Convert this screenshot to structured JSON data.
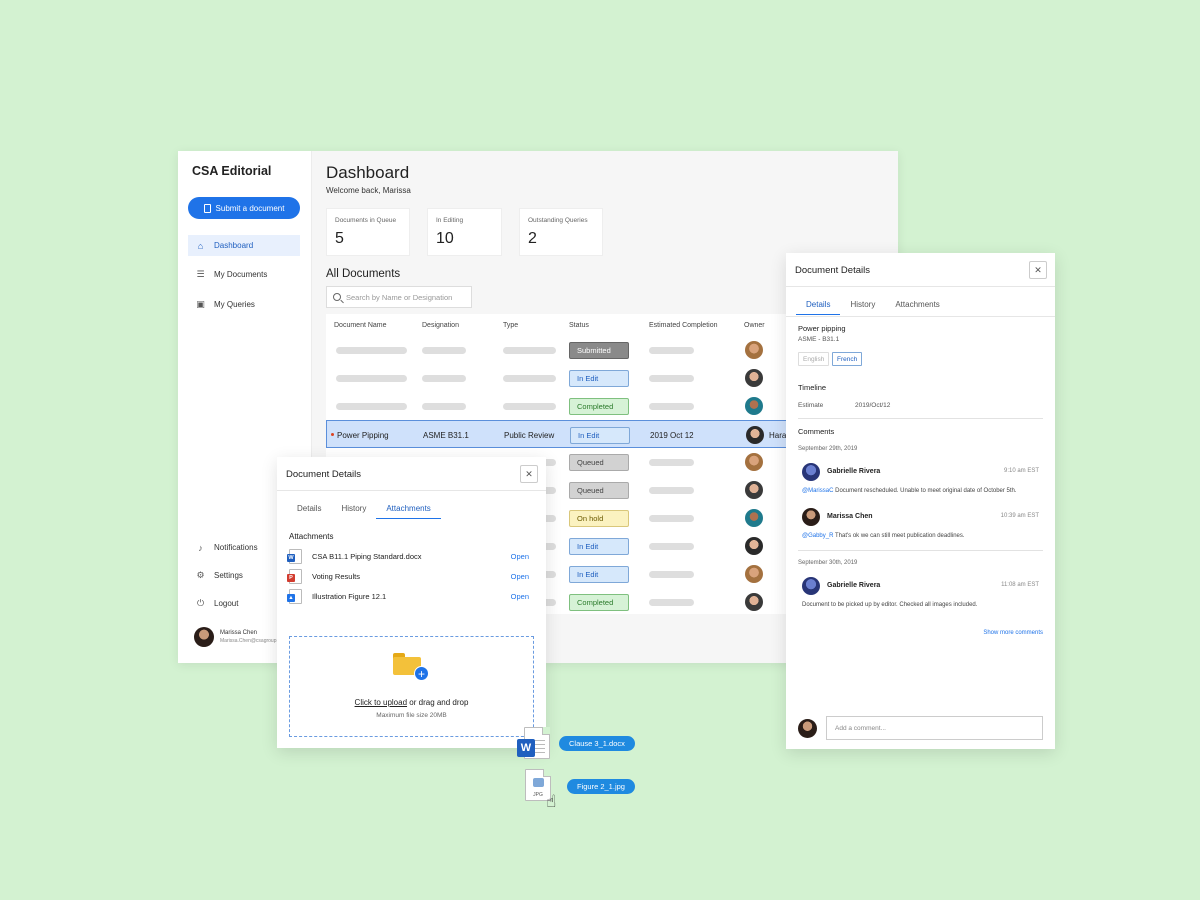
{
  "app": {
    "brand": "CSA Editorial",
    "submit_label": "Submit a document",
    "nav": [
      {
        "label": "Dashboard",
        "icon": "home-icon"
      },
      {
        "label": "My Documents",
        "icon": "list-icon"
      },
      {
        "label": "My Queries",
        "icon": "query-icon"
      }
    ],
    "bottom_nav": [
      {
        "label": "Notifications",
        "icon": "bell-icon"
      },
      {
        "label": "Settings",
        "icon": "gear-icon"
      },
      {
        "label": "Logout",
        "icon": "logout-icon"
      }
    ],
    "user": {
      "name": "Marissa Chen",
      "email": "Marissa.Chen@csagroup.org"
    }
  },
  "dashboard": {
    "title": "Dashboard",
    "welcome": "Welcome back, Marissa",
    "stats": [
      {
        "label": "Documents in Queue",
        "value": "5"
      },
      {
        "label": "In Editing",
        "value": "10"
      },
      {
        "label": "Outstanding Queries",
        "value": "2"
      }
    ],
    "section_title": "All Documents",
    "search_placeholder": "Search by Name or Designation",
    "columns": [
      "Document Name",
      "Designation",
      "Type",
      "Status",
      "Estimated Completion",
      "Owner"
    ],
    "rows": [
      {
        "status": "Submitted",
        "status_class": "submitted"
      },
      {
        "status": "In Edit",
        "status_class": "inedit"
      },
      {
        "status": "Completed",
        "status_class": "completed"
      },
      {
        "name": "Power Pipping",
        "designation": "ASME B31.1",
        "type": "Public Review",
        "status": "In Edit",
        "status_class": "inedit",
        "completion": "2019 Oct 12",
        "owner": "Hara",
        "selected": true
      },
      {
        "status": "Queued",
        "status_class": "queued"
      },
      {
        "status": "Queued",
        "status_class": "queued"
      },
      {
        "status": "On hold",
        "status_class": "onhold"
      },
      {
        "status": "In Edit",
        "status_class": "inedit"
      },
      {
        "status": "In Edit",
        "status_class": "inedit"
      },
      {
        "status": "Completed",
        "status_class": "completed"
      }
    ]
  },
  "left_panel": {
    "title": "Document Details",
    "tabs": [
      "Details",
      "History",
      "Attachments"
    ],
    "attachments_title": "Attachments",
    "attachments": [
      {
        "name": "CSA B11.1 Piping Standard.docx",
        "open": "Open",
        "badge": "W",
        "color": "#1f5fbf"
      },
      {
        "name": "Voting Results",
        "open": "Open",
        "badge": "P",
        "color": "#d23c2f"
      },
      {
        "name": "Illustration Figure 12.1",
        "open": "Open",
        "badge": "▲",
        "color": "#1f73e8"
      }
    ],
    "upload_link": "Click to upload",
    "upload_or": "or",
    "upload_drag": "drag and drop",
    "upload_max": "Maximum file size 20MB"
  },
  "right_panel": {
    "title": "Document Details",
    "tabs": [
      "Details",
      "History",
      "Attachments"
    ],
    "doc_name": "Power pipping",
    "doc_designation": "ASME - B31.1",
    "languages": [
      "English",
      "French"
    ],
    "timeline_title": "Timeline",
    "estimate_label": "Estimate",
    "estimate_value": "2019/Oct/12",
    "comments_title": "Comments",
    "comment_groups": [
      {
        "date": "September 29th, 2019",
        "comments": [
          {
            "author": "Gabrielle Rivera",
            "time": "9:10 am EST",
            "mention": "@MarissaC",
            "text": " Document rescheduled. Unable to meet original date of October 5th."
          },
          {
            "author": "Marissa Chen",
            "time": "10:39 am EST",
            "mention": "@Gabby_R",
            "text": " That's ok we can still meet publication deadlines."
          }
        ]
      },
      {
        "date": "September 30th, 2019",
        "comments": [
          {
            "author": "Gabrielle Rivera",
            "time": "11:08 am EST",
            "mention": "",
            "text": "Document to be picked up by editor. Checked all images included."
          }
        ]
      }
    ],
    "show_more": "Show more comments",
    "comment_placeholder": "Add a comment..."
  },
  "drag": {
    "file1": "Clause 3_1.docx",
    "file2": "Figure 2_1.jpg",
    "file2_ext": "JPG"
  }
}
